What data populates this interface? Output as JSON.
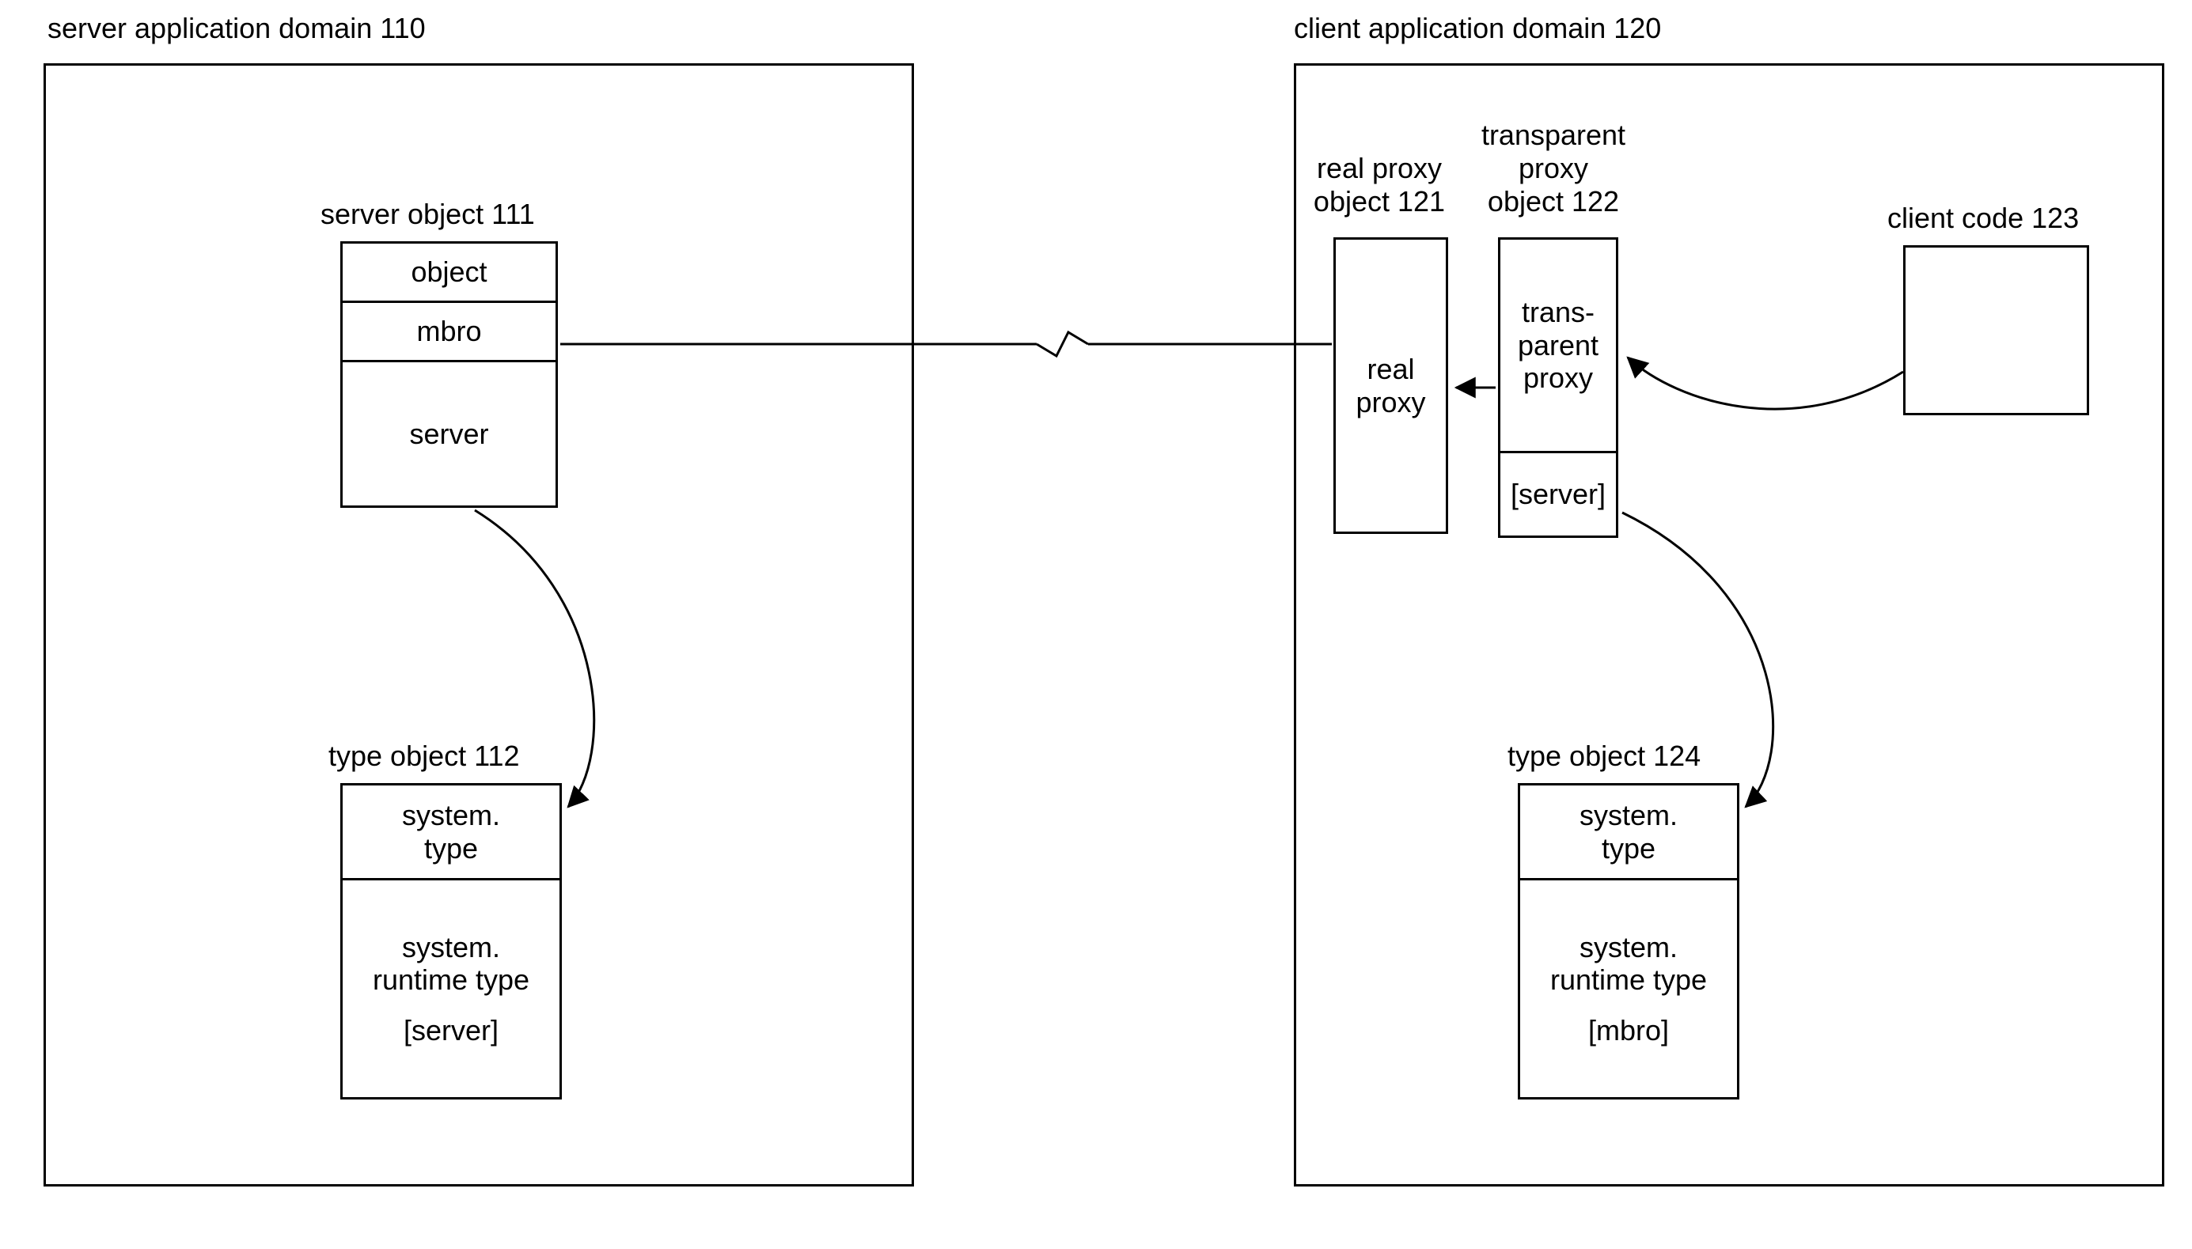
{
  "server_domain": {
    "title": "server application domain 110"
  },
  "client_domain": {
    "title": "client application domain 120"
  },
  "server_object": {
    "title": "server object 111",
    "cell0": "object",
    "cell1": "mbro",
    "cell2": "server"
  },
  "type_object_112": {
    "title": "type object 112",
    "cell0a": "system.",
    "cell0b": "type",
    "cell1a": "system.",
    "cell1b": "runtime type",
    "cell1c": "[server]"
  },
  "real_proxy": {
    "title_a": "real proxy",
    "title_b": "object 121",
    "cell0a": "real",
    "cell0b": "proxy"
  },
  "transparent_proxy": {
    "title_a": "transparent",
    "title_b": "proxy",
    "title_c": "object 122",
    "cell0a": "trans-",
    "cell0b": "parent",
    "cell0c": "proxy",
    "cell1": "[server]"
  },
  "client_code": {
    "title": "client code 123"
  },
  "type_object_124": {
    "title": "type object 124",
    "cell0a": "system.",
    "cell0b": "type",
    "cell1a": "system.",
    "cell1b": "runtime type",
    "cell1c": "[mbro]"
  }
}
